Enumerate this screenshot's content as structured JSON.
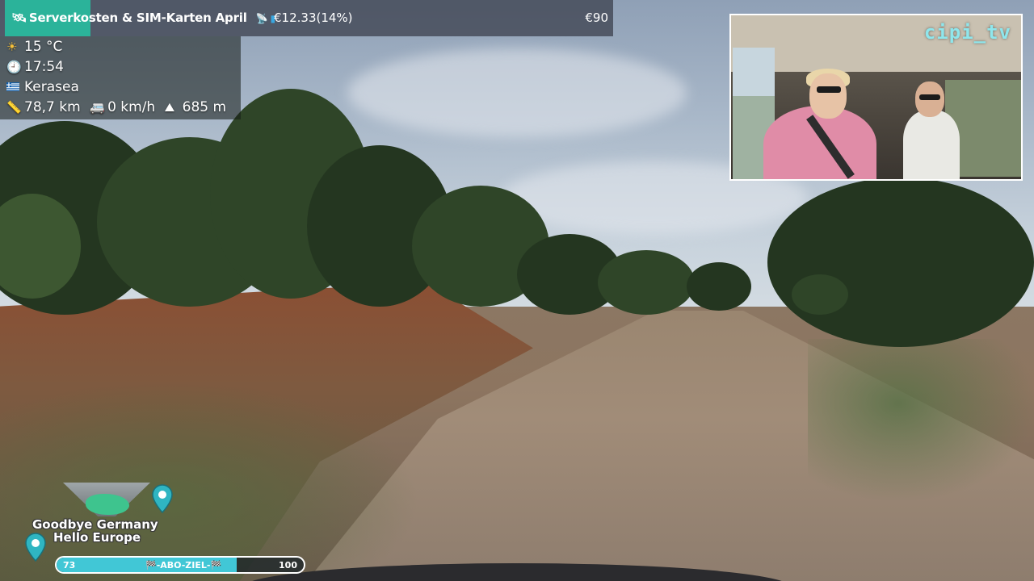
{
  "banner": {
    "title": "Serverkosten & SIM-Karten April",
    "amount": "€12.33(14%)",
    "goal": "€90",
    "icons": [
      "satellite-icon",
      "sim-card-icon"
    ]
  },
  "info": {
    "temperature": "15 °C",
    "time": "17:54",
    "location": "Kerasea",
    "distance": "78,7 km",
    "speed": "0 km/h",
    "altitude": "685 m",
    "icons": [
      "sun-icon",
      "clock-icon",
      "greece-flag-icon",
      "ruler-icon",
      "van-icon",
      "mountain-icon"
    ]
  },
  "cam": {
    "label": "cipi_tv"
  },
  "logo": {
    "line1": "Goodbye Germany",
    "line2": "Hello Europe"
  },
  "progress": {
    "start": "73",
    "label": "🏁-ABO-ZIEL-🏁",
    "end": "100",
    "fraction": 0.73
  },
  "colors": {
    "banner_tag": "#2bb39a",
    "progress_fill": "#41c7d6",
    "cam_label": "#8fe6ec"
  }
}
